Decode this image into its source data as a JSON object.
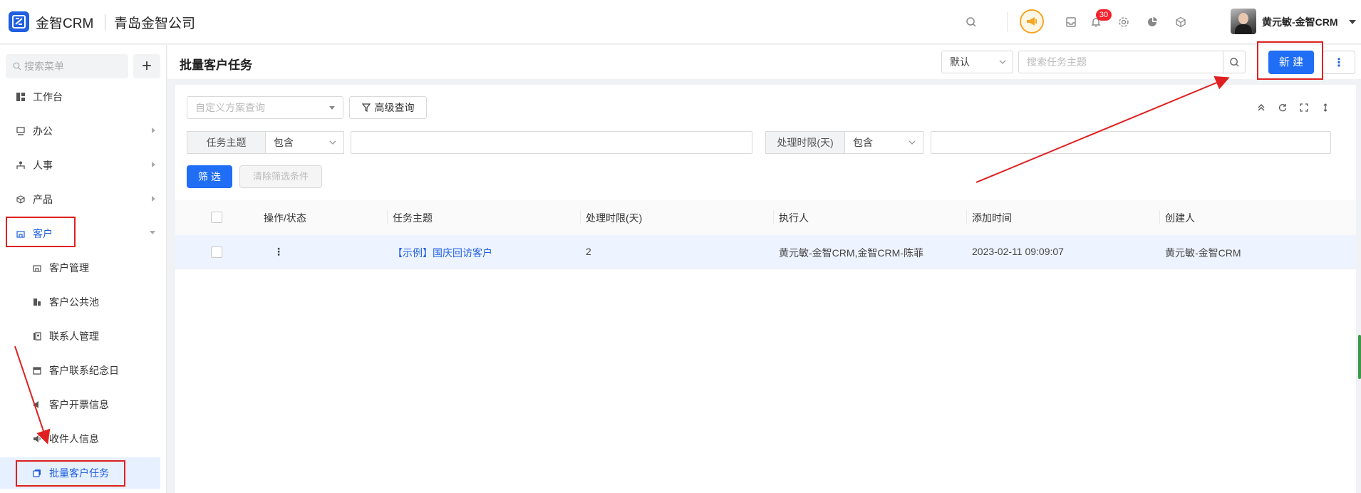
{
  "header": {
    "brand": "金智CRM",
    "company": "青岛金智公司",
    "notification_count": "30",
    "username": "黄元敏-金智CRM"
  },
  "sidebar": {
    "search_placeholder": "搜索菜单",
    "add_label": "+",
    "items": [
      {
        "label": "工作台",
        "icon": "dashboard-icon"
      },
      {
        "label": "办公",
        "icon": "monitor-icon"
      },
      {
        "label": "人事",
        "icon": "org-icon"
      },
      {
        "label": "产品",
        "icon": "cube-icon"
      },
      {
        "label": "客户",
        "icon": "building-icon"
      }
    ],
    "sub_items": [
      {
        "label": "客户管理",
        "icon": "building-icon"
      },
      {
        "label": "客户公共池",
        "icon": "pool-icon"
      },
      {
        "label": "联系人管理",
        "icon": "contact-card-icon"
      },
      {
        "label": "客户联系纪念日",
        "icon": "calendar-icon"
      },
      {
        "label": "客户开票信息",
        "icon": "invoice-icon"
      },
      {
        "label": "收件人信息",
        "icon": "speaker-icon"
      },
      {
        "label": "批量客户任务",
        "icon": "task-stack-icon"
      }
    ]
  },
  "page": {
    "title": "批量客户任务",
    "view_select": "默认",
    "search_placeholder": "搜索任务主题",
    "new_label": "新 建",
    "more_label": "⋮"
  },
  "filters": {
    "scheme_placeholder": "自定义方案查询",
    "advanced_label": "高级查询",
    "field1_label": "任务主题",
    "field1_op": "包含",
    "field2_label": "处理时限(天)",
    "field2_op": "包含",
    "filter_btn": "筛 选",
    "clear_btn": "清除筛选条件"
  },
  "table": {
    "columns": [
      "操作/状态",
      "任务主题",
      "处理时限(天)",
      "执行人",
      "添加时间",
      "创建人"
    ],
    "rows": [
      {
        "action": "⋮",
        "subject": "【示例】国庆回访客户",
        "deadline": "2",
        "executor": "黄元敏-金智CRM,金智CRM-陈菲",
        "added": "2023-02-11 09:09:07",
        "creator": "黄元敏-金智CRM"
      }
    ]
  },
  "colors": {
    "primary": "#1f6ef5",
    "annotation_red": "#e02020"
  }
}
